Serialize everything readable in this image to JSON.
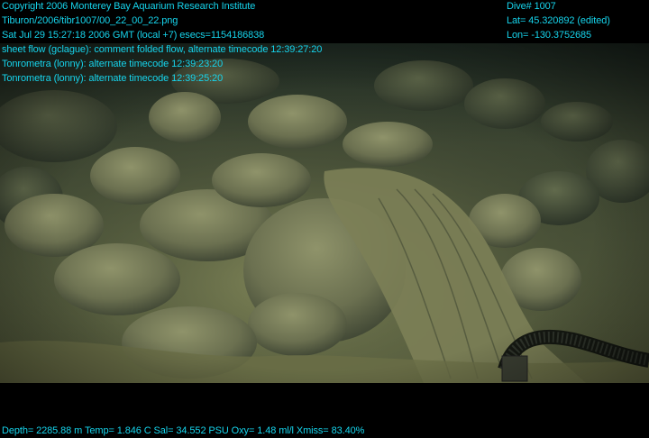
{
  "overlay_top_left": [
    "Copyright 2006 Monterey Bay Aquarium Research Institute",
    "Tiburon/2006/tibr1007/00_22_00_22.png",
    "Sat Jul 29 15:27:18 2006 GMT (local +7)  esecs=1154186838",
    "sheet flow (gclague): comment folded flow, alternate timecode 12:39:27:20",
    "Tonrometra (lonny): alternate timecode 12:39:23:20",
    "Tonrometra (lonny): alternate timecode 12:39:25:20"
  ],
  "overlay_top_right": [
    "Dive# 1007",
    "Lat= 45.320892 (edited)",
    "Lon= -130.3752685"
  ],
  "overlay_bottom": "Depth= 2285.88 m  Temp= 1.846 C  Sal= 34.552 PSU  Oxy= 1.48 ml/l  Xmiss= 83.40%",
  "colors": {
    "overlay_text": "#16d4ec",
    "letterbox": "#000000",
    "seafloor": "#6f7548"
  }
}
